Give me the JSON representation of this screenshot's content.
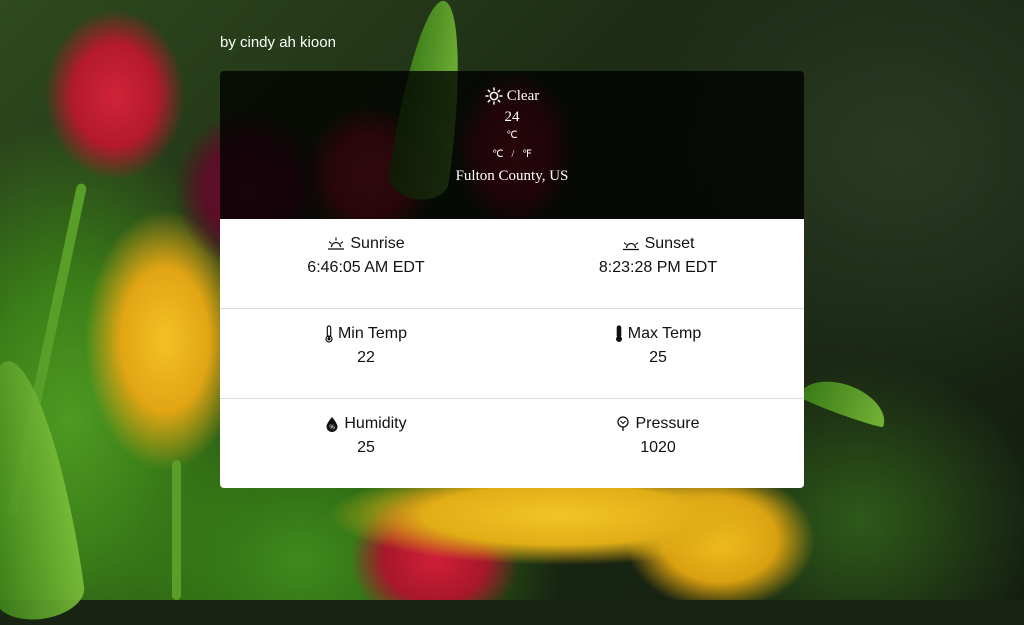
{
  "credit": "by cindy ah kioon",
  "weather": {
    "condition": "Clear",
    "condition_icon": "sun-icon",
    "temperature": "24",
    "unit": "℃",
    "toggle_c": "℃",
    "toggle_sep": "/",
    "toggle_f": "℉",
    "location": "Fulton County, US"
  },
  "details": {
    "sunrise_label": "Sunrise",
    "sunrise_value": "6:46:05 AM EDT",
    "sunset_label": "Sunset",
    "sunset_value": "8:23:28 PM EDT",
    "min_label": "Min Temp",
    "min_value": "22",
    "max_label": "Max Temp",
    "max_value": "25",
    "humidity_label": "Humidity",
    "humidity_value": "25",
    "pressure_label": "Pressure",
    "pressure_value": "1020"
  },
  "colors": {
    "card_top_bg": "#000000",
    "card_bottom_bg": "#ffffff",
    "text_light": "#ffffff",
    "text_dark": "#111111"
  }
}
